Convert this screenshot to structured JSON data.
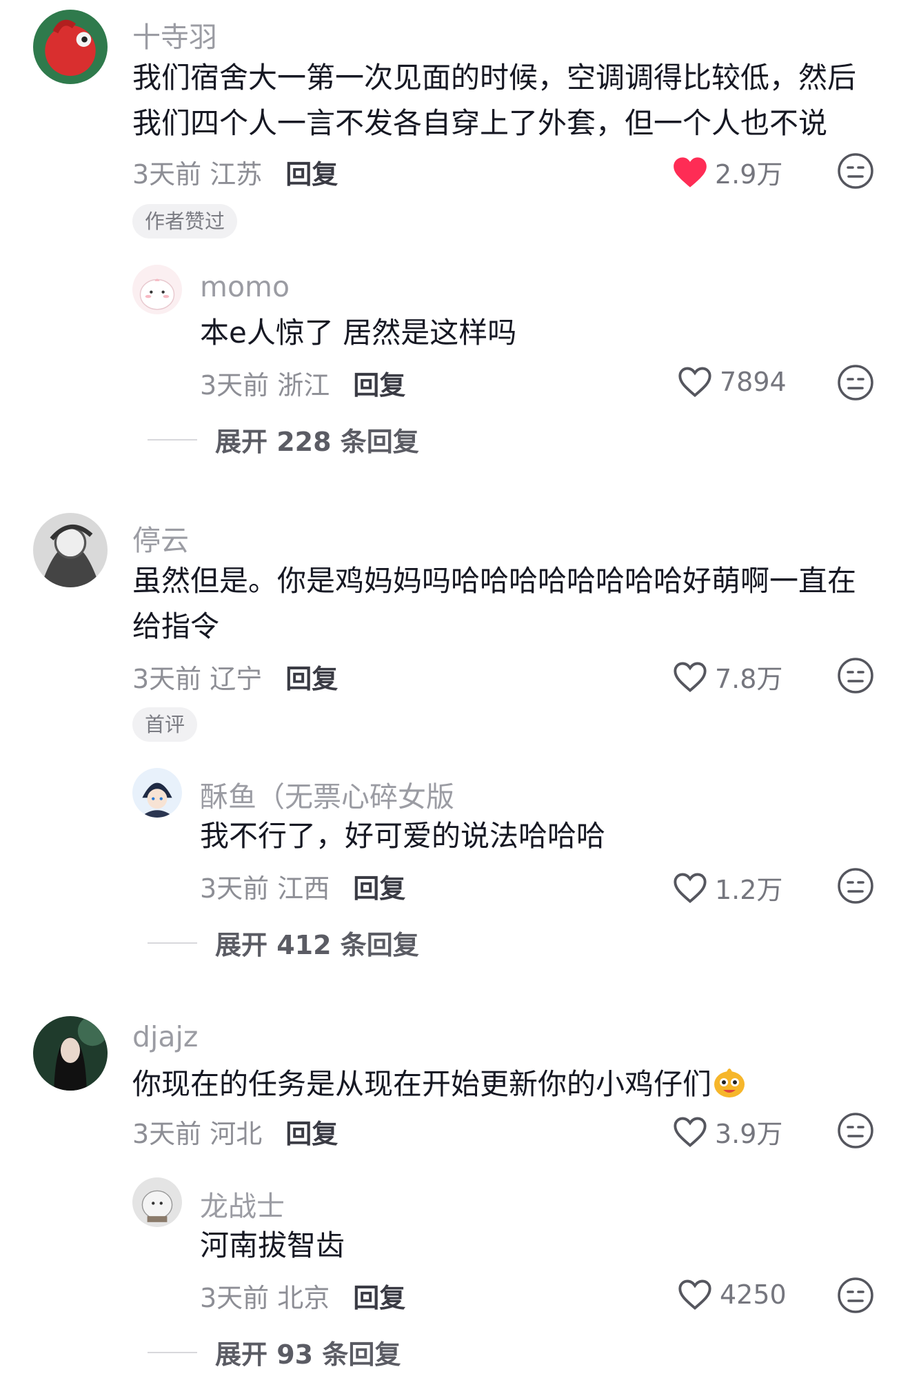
{
  "comments": [
    {
      "username": "十寺羽",
      "text": "我们宿舍大一第一次见面的时候，空调调得比较低，然后我们四个人一言不发各自穿上了外套，但一个人也不说",
      "time_location": "3天前 江苏",
      "reply_label": "回复",
      "likes": "2.9万",
      "liked": true,
      "tag": "作者赞过",
      "reply": {
        "username": "momo",
        "text": "本e人惊了 居然是这样吗",
        "time_location": "3天前 浙江",
        "reply_label": "回复",
        "likes": "7894"
      },
      "expand": "展开 228 条回复"
    },
    {
      "username": "停云",
      "text": "虽然但是。你是鸡妈妈吗哈哈哈哈哈哈哈哈好萌啊一直在给指令",
      "time_location": "3天前 辽宁",
      "reply_label": "回复",
      "likes": "7.8万",
      "liked": false,
      "tag": "首评",
      "reply": {
        "username": "酥鱼（无票心碎女版",
        "text": "我不行了，好可爱的说法哈哈哈",
        "time_location": "3天前 江西",
        "reply_label": "回复",
        "likes": "1.2万"
      },
      "expand": "展开 412 条回复"
    },
    {
      "username": "djajz",
      "text": "你现在的任务是从现在开始更新你的小鸡仔们",
      "emoji": "smiling-face-emoji",
      "time_location": "3天前 河北",
      "reply_label": "回复",
      "likes": "3.9万",
      "liked": false,
      "reply": {
        "username": "龙战士",
        "text": "河南拔智齿",
        "time_location": "3天前 北京",
        "reply_label": "回复",
        "likes": "4250"
      },
      "expand": "展开 93 条回复"
    }
  ],
  "colors": {
    "liked_red": "#fe2c55",
    "username_gray": "#9b9ca3",
    "text_dark": "#161823"
  }
}
